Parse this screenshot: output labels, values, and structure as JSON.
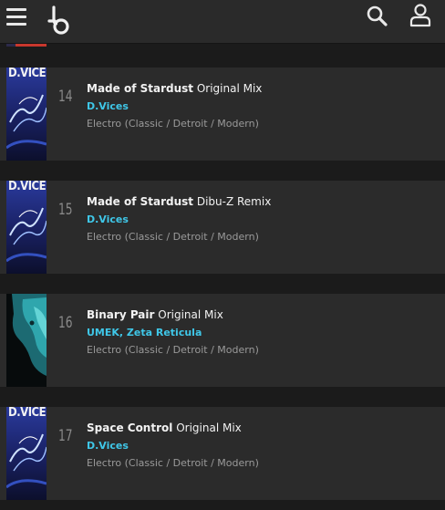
{
  "header": {
    "menu_icon": "hamburger-menu-icon",
    "logo_icon": "beatport-logo-icon",
    "search_icon": "search-icon",
    "account_icon": "user-account-icon"
  },
  "colors": {
    "background": "#1b1b1b",
    "row_background": "#2b2b2b",
    "topbar": "#2a2a2a",
    "artist_accent": "#3fc7e8",
    "number": "#8a8a8a",
    "genre": "#9a9a9a"
  },
  "tracks": [
    {
      "number": "14",
      "name": "Made of Stardust",
      "mix": "Original Mix",
      "artists": "D.Vices",
      "genre": "Electro (Classic / Detroit / Modern)",
      "artwork_text": "D.VICES"
    },
    {
      "number": "15",
      "name": "Made of Stardust",
      "mix": "Dibu-Z Remix",
      "artists": "D.Vices",
      "genre": "Electro (Classic / Detroit / Modern)",
      "artwork_text": "D.VICES"
    },
    {
      "number": "16",
      "name": "Binary Pair",
      "mix": "Original Mix",
      "artists": "UMEK, Zeta Reticula",
      "genre": "Electro (Classic / Detroit / Modern)",
      "artwork_text": ""
    },
    {
      "number": "17",
      "name": "Space Control",
      "mix": "Original Mix",
      "artists": "D.Vices",
      "genre": "Electro (Classic / Detroit / Modern)",
      "artwork_text": "D.VICES"
    }
  ]
}
